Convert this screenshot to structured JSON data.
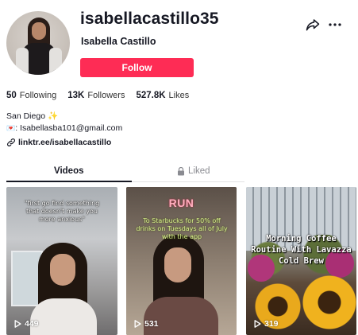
{
  "profile": {
    "username": "isabellacastillo35",
    "display_name": "Isabella Castillo",
    "follow_label": "Follow"
  },
  "header_icons": [
    "share-icon",
    "more-icon"
  ],
  "stats": {
    "following_count": "50",
    "following_label": "Following",
    "followers_count": "13K",
    "followers_label": "Followers",
    "likes_count": "527.8K",
    "likes_label": "Likes"
  },
  "bio": {
    "location": "San Diego",
    "location_emoji": "✨",
    "email_emoji": "💌",
    "email_line": ": Isabellasba101@gmail.com",
    "link": "linktr.ee/isabellacastillo"
  },
  "tabs": {
    "videos_label": "Videos",
    "liked_label": "Liked"
  },
  "videos": [
    {
      "caption": "\"first go find something that doesn't make you more anxious\"",
      "views": "449"
    },
    {
      "overlay_title": "RUN",
      "caption": "To Starbucks for 50% off drinks on Tuesdays all of July with the app",
      "views": "531"
    },
    {
      "caption": "Morning Coffee Routine With Lavazza Cold Brew",
      "views": "319"
    }
  ],
  "colors": {
    "follow_button": "#fe2c55",
    "text_primary": "#161823",
    "text_secondary": "#8a8b91"
  }
}
